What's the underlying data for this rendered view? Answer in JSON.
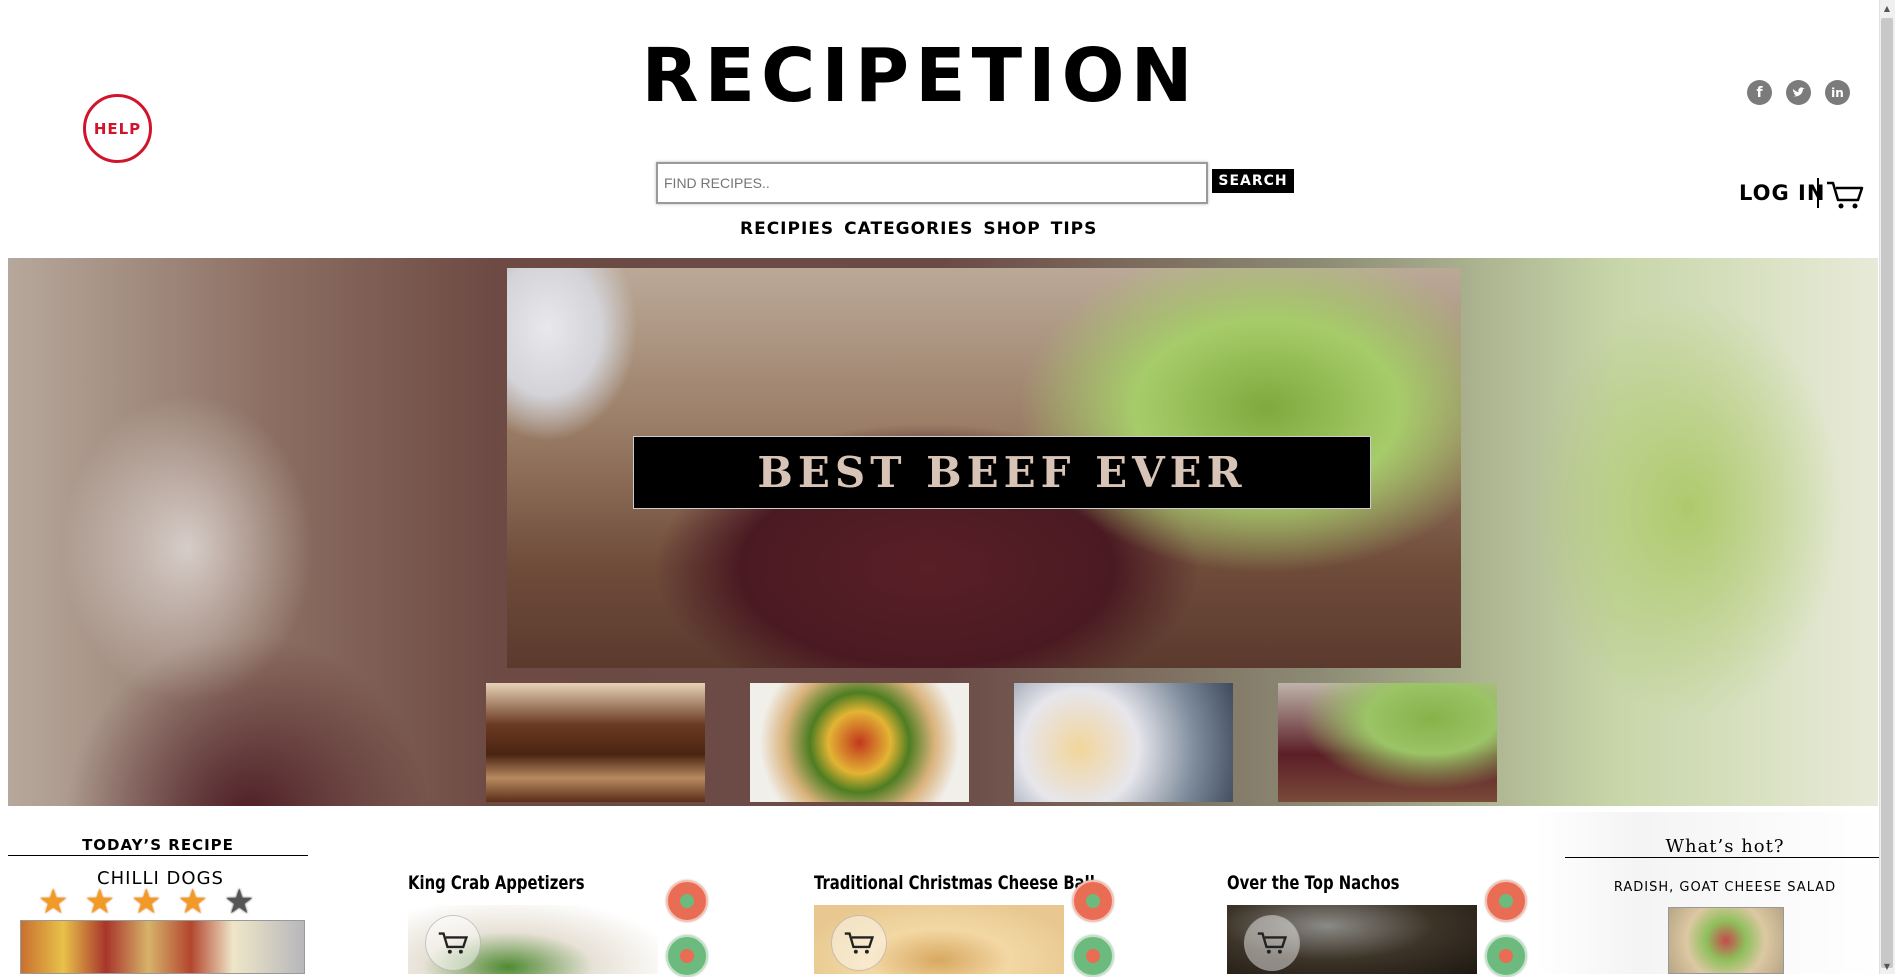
{
  "header": {
    "help_label": "HELP",
    "logo_text": "RECIPETION",
    "search": {
      "placeholder": "FIND RECIPES..",
      "button_label": "SEARCH"
    },
    "nav": [
      "RECIPIES",
      "CATEGORIES",
      "SHOP",
      "TIPS"
    ],
    "social": [
      "facebook-icon",
      "twitter-icon",
      "linkedin-icon"
    ],
    "login_label": "LOG IN"
  },
  "hero": {
    "banner_text": "BEST BEEF EVER",
    "thumbnails": [
      "brownies",
      "pita-veggie",
      "pancakes",
      "beef-salad"
    ]
  },
  "todays_recipe": {
    "heading": "TODAY’S RECIPE",
    "dish": "CHILLI DOGS",
    "rating": 4,
    "max_rating": 5
  },
  "cards": [
    {
      "title": "King Crab Appetizers"
    },
    {
      "title": "Traditional Christmas Cheese Ball"
    },
    {
      "title": "Over the Top Nachos"
    }
  ],
  "whats_hot": {
    "heading": "What’s hot?",
    "item": "RADISH, GOAT CHEESE SALAD"
  },
  "colors": {
    "help_red": "#d0142c",
    "badge_orange": "#e96d55",
    "badge_green": "#6cba7d",
    "star_on": "#f29a25",
    "star_off": "#555555"
  }
}
